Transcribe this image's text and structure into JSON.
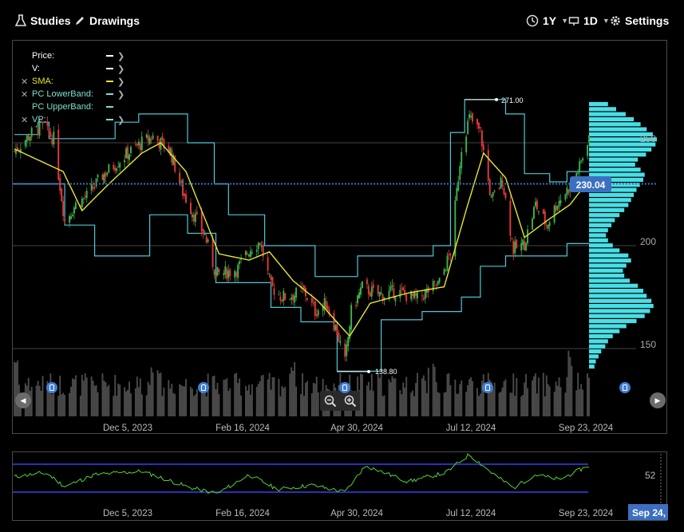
{
  "toolbar": {
    "studies_label": "Studies",
    "drawings_label": "Drawings",
    "range_label": "1Y",
    "interval_label": "1D",
    "settings_label": "Settings"
  },
  "legend": [
    {
      "label": "Price:",
      "color": "#ffffff",
      "removable": false,
      "expandable": true
    },
    {
      "label": "V:",
      "color": "#ffffff",
      "removable": false,
      "expandable": true
    },
    {
      "label": "SMA:",
      "color": "#e6e62e",
      "removable": true,
      "expandable": true
    },
    {
      "label": "PC LowerBand:",
      "color": "#7de0d0",
      "removable": true,
      "expandable": true
    },
    {
      "label": "PC UpperBand:",
      "color": "#7de0d0",
      "removable": false,
      "expandable": false
    },
    {
      "label": "VP:",
      "color": "#7de0d0",
      "removable": true,
      "expandable": true
    }
  ],
  "price_labels": {
    "current": "230.04",
    "high_marker": "271.00",
    "low_marker": "138.80",
    "y_ticks": [
      "250",
      "200",
      "150"
    ]
  },
  "x_axis_labels": [
    "Dec 5, 2023",
    "Feb 16, 2024",
    "Apr 30, 2024",
    "Jul 12, 2024",
    "Sep 23, 2024"
  ],
  "rsi": {
    "tick_label": "52",
    "current_date_label": "Sep 24,"
  },
  "colors": {
    "up": "#3db24a",
    "down": "#e23b3b",
    "sma": "#e6e62e",
    "band": "#4dc8d8",
    "volume_profile": "#49dfe6",
    "current_price": "#3d6fc0",
    "rsi_line": "#4fd23a",
    "rsi_band": "#3344ee",
    "marker": "#3f7fd4"
  },
  "chart_data": {
    "type": "candlestick",
    "x_range": [
      "2023-09-25",
      "2024-09-24"
    ],
    "ylim": [
      135,
      282
    ],
    "y_ticks": [
      150,
      200,
      250
    ],
    "current_price": 230.04,
    "channel_high": 271.0,
    "channel_low": 138.8,
    "close_anchors": [
      {
        "date": "2023-09-25",
        "close": 246
      },
      {
        "date": "2023-10-05",
        "close": 254
      },
      {
        "date": "2023-10-12",
        "close": 258
      },
      {
        "date": "2023-10-20",
        "close": 252
      },
      {
        "date": "2023-10-27",
        "close": 212
      },
      {
        "date": "2023-11-03",
        "close": 220
      },
      {
        "date": "2023-11-10",
        "close": 224
      },
      {
        "date": "2023-11-20",
        "close": 234
      },
      {
        "date": "2023-11-30",
        "close": 241
      },
      {
        "date": "2023-12-08",
        "close": 246
      },
      {
        "date": "2023-12-15",
        "close": 250
      },
      {
        "date": "2023-12-22",
        "close": 253
      },
      {
        "date": "2024-01-02",
        "close": 246
      },
      {
        "date": "2024-01-10",
        "close": 226
      },
      {
        "date": "2024-01-17",
        "close": 215
      },
      {
        "date": "2024-01-24",
        "close": 205
      },
      {
        "date": "2024-01-31",
        "close": 186
      },
      {
        "date": "2024-02-07",
        "close": 187
      },
      {
        "date": "2024-02-14",
        "close": 189
      },
      {
        "date": "2024-02-21",
        "close": 198
      },
      {
        "date": "2024-02-28",
        "close": 202
      },
      {
        "date": "2024-03-06",
        "close": 180
      },
      {
        "date": "2024-03-13",
        "close": 175
      },
      {
        "date": "2024-03-20",
        "close": 176
      },
      {
        "date": "2024-03-27",
        "close": 178
      },
      {
        "date": "2024-04-03",
        "close": 168
      },
      {
        "date": "2024-04-10",
        "close": 172
      },
      {
        "date": "2024-04-17",
        "close": 158
      },
      {
        "date": "2024-04-22",
        "close": 143
      },
      {
        "date": "2024-04-26",
        "close": 168
      },
      {
        "date": "2024-05-03",
        "close": 180
      },
      {
        "date": "2024-05-10",
        "close": 177
      },
      {
        "date": "2024-05-17",
        "close": 176
      },
      {
        "date": "2024-05-24",
        "close": 178
      },
      {
        "date": "2024-05-31",
        "close": 176
      },
      {
        "date": "2024-06-07",
        "close": 174
      },
      {
        "date": "2024-06-14",
        "close": 178
      },
      {
        "date": "2024-06-21",
        "close": 182
      },
      {
        "date": "2024-06-28",
        "close": 197
      },
      {
        "date": "2024-07-05",
        "close": 248
      },
      {
        "date": "2024-07-10",
        "close": 262
      },
      {
        "date": "2024-07-17",
        "close": 255
      },
      {
        "date": "2024-07-24",
        "close": 222
      },
      {
        "date": "2024-07-31",
        "close": 232
      },
      {
        "date": "2024-08-07",
        "close": 198
      },
      {
        "date": "2024-08-14",
        "close": 201
      },
      {
        "date": "2024-08-21",
        "close": 220
      },
      {
        "date": "2024-08-28",
        "close": 210
      },
      {
        "date": "2024-09-04",
        "close": 221
      },
      {
        "date": "2024-09-11",
        "close": 228
      },
      {
        "date": "2024-09-18",
        "close": 238
      },
      {
        "date": "2024-09-24",
        "close": 254
      }
    ],
    "sma_anchors": [
      {
        "date": "2023-09-25",
        "value": 247
      },
      {
        "date": "2023-10-26",
        "value": 236
      },
      {
        "date": "2023-11-07",
        "value": 217
      },
      {
        "date": "2023-11-24",
        "value": 230
      },
      {
        "date": "2023-12-15",
        "value": 245
      },
      {
        "date": "2023-12-27",
        "value": 250
      },
      {
        "date": "2024-01-12",
        "value": 236
      },
      {
        "date": "2024-02-02",
        "value": 196
      },
      {
        "date": "2024-02-21",
        "value": 193
      },
      {
        "date": "2024-03-05",
        "value": 197
      },
      {
        "date": "2024-03-20",
        "value": 183
      },
      {
        "date": "2024-04-05",
        "value": 173
      },
      {
        "date": "2024-04-25",
        "value": 156
      },
      {
        "date": "2024-05-08",
        "value": 172
      },
      {
        "date": "2024-06-01",
        "value": 177
      },
      {
        "date": "2024-06-24",
        "value": 180
      },
      {
        "date": "2024-07-09",
        "value": 220
      },
      {
        "date": "2024-07-19",
        "value": 245
      },
      {
        "date": "2024-08-02",
        "value": 233
      },
      {
        "date": "2024-08-14",
        "value": 204
      },
      {
        "date": "2024-08-28",
        "value": 212
      },
      {
        "date": "2024-09-12",
        "value": 220
      },
      {
        "date": "2024-09-24",
        "value": 232
      }
    ],
    "upper_band_steps": [
      {
        "from": "2023-09-25",
        "to": "2023-10-10",
        "value": 254
      },
      {
        "from": "2023-10-10",
        "to": "2023-10-17",
        "value": 260
      },
      {
        "from": "2023-10-17",
        "to": "2023-11-28",
        "value": 252
      },
      {
        "from": "2023-11-28",
        "to": "2023-12-13",
        "value": 260
      },
      {
        "from": "2023-12-13",
        "to": "2024-01-13",
        "value": 264
      },
      {
        "from": "2024-01-13",
        "to": "2024-01-30",
        "value": 250
      },
      {
        "from": "2024-01-30",
        "to": "2024-02-08",
        "value": 230
      },
      {
        "from": "2024-02-08",
        "to": "2024-03-02",
        "value": 215
      },
      {
        "from": "2024-03-02",
        "to": "2024-04-03",
        "value": 200
      },
      {
        "from": "2024-04-03",
        "to": "2024-04-30",
        "value": 185
      },
      {
        "from": "2024-04-30",
        "to": "2024-06-17",
        "value": 195
      },
      {
        "from": "2024-06-17",
        "to": "2024-06-28",
        "value": 200
      },
      {
        "from": "2024-06-28",
        "to": "2024-07-07",
        "value": 255
      },
      {
        "from": "2024-07-07",
        "to": "2024-08-02",
        "value": 271
      },
      {
        "from": "2024-08-02",
        "to": "2024-08-14",
        "value": 264
      },
      {
        "from": "2024-08-14",
        "to": "2024-08-30",
        "value": 235
      },
      {
        "from": "2024-08-30",
        "to": "2024-09-10",
        "value": 231
      },
      {
        "from": "2024-09-10",
        "to": "2024-09-24",
        "value": 236
      }
    ],
    "lower_band_steps": [
      {
        "from": "2023-09-25",
        "to": "2023-10-27",
        "value": 230
      },
      {
        "from": "2023-10-27",
        "to": "2023-11-15",
        "value": 210
      },
      {
        "from": "2023-11-15",
        "to": "2023-12-20",
        "value": 195
      },
      {
        "from": "2023-12-20",
        "to": "2024-01-13",
        "value": 215
      },
      {
        "from": "2024-01-13",
        "to": "2024-01-31",
        "value": 206
      },
      {
        "from": "2024-01-31",
        "to": "2024-03-06",
        "value": 182
      },
      {
        "from": "2024-03-06",
        "to": "2024-03-25",
        "value": 170
      },
      {
        "from": "2024-03-25",
        "to": "2024-04-17",
        "value": 163
      },
      {
        "from": "2024-04-17",
        "to": "2024-05-15",
        "value": 139
      },
      {
        "from": "2024-05-15",
        "to": "2024-06-10",
        "value": 164
      },
      {
        "from": "2024-06-10",
        "to": "2024-07-05",
        "value": 168
      },
      {
        "from": "2024-07-05",
        "to": "2024-07-17",
        "value": 175
      },
      {
        "from": "2024-07-17",
        "to": "2024-08-02",
        "value": 190
      },
      {
        "from": "2024-08-02",
        "to": "2024-09-10",
        "value": 195
      },
      {
        "from": "2024-09-10",
        "to": "2024-09-24",
        "value": 201
      }
    ],
    "volume_profile": {
      "price_range": [
        140,
        270
      ],
      "relative_volume": [
        0.08,
        0.1,
        0.14,
        0.18,
        0.24,
        0.28,
        0.35,
        0.45,
        0.55,
        0.7,
        0.82,
        0.9,
        0.95,
        0.92,
        0.85,
        0.8,
        0.72,
        0.6,
        0.52,
        0.5,
        0.55,
        0.62,
        0.58,
        0.45,
        0.35,
        0.28,
        0.25,
        0.28,
        0.33,
        0.38,
        0.45,
        0.52,
        0.58,
        0.62,
        0.66,
        0.7,
        0.75,
        0.8,
        0.82,
        0.76,
        0.68,
        0.72,
        0.84,
        0.92,
        0.98,
        1.0,
        0.94,
        0.85,
        0.76,
        0.66,
        0.54,
        0.4,
        0.28
      ]
    },
    "rsi": {
      "bands": [
        30,
        70
      ],
      "ylim": [
        10,
        90
      ],
      "anchors": [
        {
          "date": "2023-09-25",
          "value": 52
        },
        {
          "date": "2023-10-15",
          "value": 58
        },
        {
          "date": "2023-10-27",
          "value": 38
        },
        {
          "date": "2023-11-15",
          "value": 55
        },
        {
          "date": "2023-12-15",
          "value": 60
        },
        {
          "date": "2024-01-15",
          "value": 36
        },
        {
          "date": "2024-02-01",
          "value": 28
        },
        {
          "date": "2024-02-21",
          "value": 55
        },
        {
          "date": "2024-03-10",
          "value": 34
        },
        {
          "date": "2024-04-01",
          "value": 40
        },
        {
          "date": "2024-04-22",
          "value": 30
        },
        {
          "date": "2024-05-05",
          "value": 68
        },
        {
          "date": "2024-06-01",
          "value": 45
        },
        {
          "date": "2024-06-25",
          "value": 58
        },
        {
          "date": "2024-07-10",
          "value": 84
        },
        {
          "date": "2024-07-24",
          "value": 58
        },
        {
          "date": "2024-08-07",
          "value": 36
        },
        {
          "date": "2024-08-21",
          "value": 55
        },
        {
          "date": "2024-09-05",
          "value": 48
        },
        {
          "date": "2024-09-24",
          "value": 68
        }
      ]
    }
  }
}
